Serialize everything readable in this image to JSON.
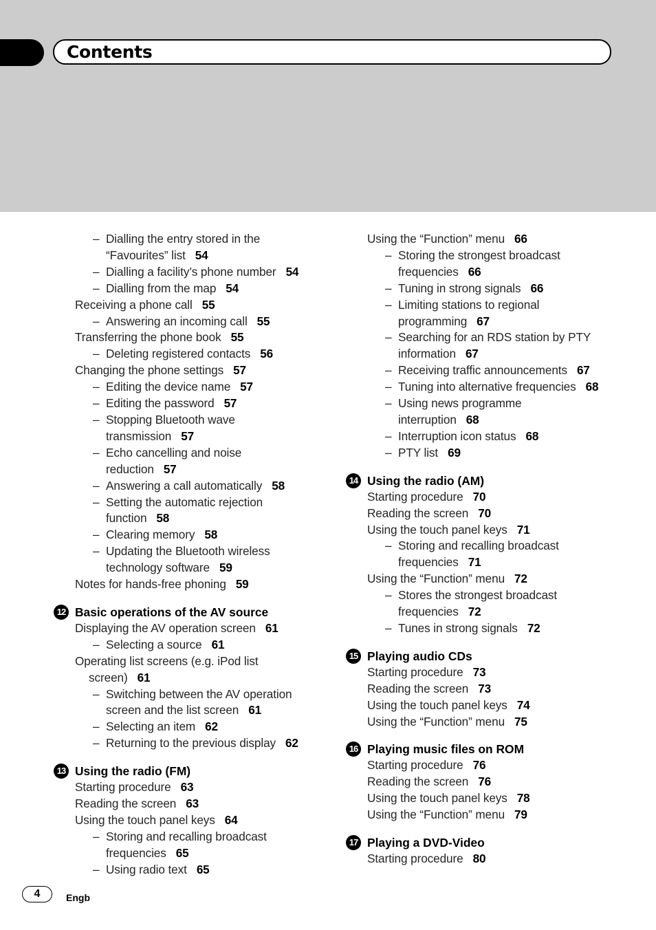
{
  "header": {
    "title": "Contents"
  },
  "left_column": {
    "intro_entries": [
      {
        "level": 2,
        "text": "Dialling the entry stored in the",
        "cont": "“Favourites” list",
        "page": "54"
      },
      {
        "level": 2,
        "text": "Dialling a facility’s phone number",
        "page": "54"
      },
      {
        "level": 2,
        "text": "Dialling from the map",
        "page": "54"
      },
      {
        "level": 1,
        "text": "Receiving a phone call",
        "page": "55"
      },
      {
        "level": 2,
        "text": "Answering an incoming call",
        "page": "55"
      },
      {
        "level": 1,
        "text": "Transferring the phone book",
        "page": "55"
      },
      {
        "level": 2,
        "text": "Deleting registered contacts",
        "page": "56"
      },
      {
        "level": 1,
        "text": "Changing the phone settings",
        "page": "57"
      },
      {
        "level": 2,
        "text": "Editing the device name",
        "page": "57"
      },
      {
        "level": 2,
        "text": "Editing the password",
        "page": "57"
      },
      {
        "level": 2,
        "text": "Stopping Bluetooth wave",
        "cont": "transmission",
        "page": "57"
      },
      {
        "level": 2,
        "text": "Echo cancelling and noise",
        "cont": "reduction",
        "page": "57"
      },
      {
        "level": 2,
        "text": "Answering a call automatically",
        "page": "58"
      },
      {
        "level": 2,
        "text": "Setting the automatic rejection",
        "cont": "function",
        "page": "58"
      },
      {
        "level": 2,
        "text": "Clearing memory",
        "page": "58"
      },
      {
        "level": 2,
        "text": "Updating the Bluetooth wireless",
        "cont": "technology software",
        "page": "59"
      },
      {
        "level": 1,
        "text": "Notes for hands-free phoning",
        "page": "59"
      }
    ],
    "sections": [
      {
        "number": "12",
        "title": "Basic operations of the AV source",
        "entries": [
          {
            "level": 1,
            "text": "Displaying the AV operation screen",
            "page": "61"
          },
          {
            "level": 2,
            "text": "Selecting a source",
            "page": "61"
          },
          {
            "level": 1,
            "text": "Operating list screens (e.g. iPod list",
            "cont": "screen)",
            "page": "61"
          },
          {
            "level": 2,
            "text": "Switching between the AV operation",
            "cont": "screen and the list screen",
            "page": "61"
          },
          {
            "level": 2,
            "text": "Selecting an item",
            "page": "62"
          },
          {
            "level": 2,
            "text": "Returning to the previous display",
            "page": "62"
          }
        ]
      },
      {
        "number": "13",
        "title": "Using the radio (FM)",
        "entries": [
          {
            "level": 1,
            "text": "Starting procedure",
            "page": "63"
          },
          {
            "level": 1,
            "text": "Reading the screen",
            "page": "63"
          },
          {
            "level": 1,
            "text": "Using the touch panel keys",
            "page": "64"
          },
          {
            "level": 2,
            "text": "Storing and recalling broadcast",
            "cont": "frequencies",
            "page": "65"
          },
          {
            "level": 2,
            "text": "Using radio text",
            "page": "65"
          }
        ]
      }
    ]
  },
  "right_column": {
    "intro_entries": [
      {
        "level": 1,
        "text": "Using the “Function” menu",
        "page": "66"
      },
      {
        "level": 2,
        "text": "Storing the strongest broadcast",
        "cont": "frequencies",
        "page": "66"
      },
      {
        "level": 2,
        "text": "Tuning in strong signals",
        "page": "66"
      },
      {
        "level": 2,
        "text": "Limiting stations to regional",
        "cont": "programming",
        "page": "67"
      },
      {
        "level": 2,
        "text": "Searching for an RDS station by PTY",
        "cont": "information",
        "page": "67"
      },
      {
        "level": 2,
        "text": "Receiving traffic announcements",
        "page": "67"
      },
      {
        "level": 2,
        "text": "Tuning into alternative frequencies",
        "page": "68"
      },
      {
        "level": 2,
        "text": "Using news programme",
        "cont": "interruption",
        "page": "68"
      },
      {
        "level": 2,
        "text": "Interruption icon status",
        "page": "68"
      },
      {
        "level": 2,
        "text": "PTY list",
        "page": "69"
      }
    ],
    "sections": [
      {
        "number": "14",
        "title": "Using the radio (AM)",
        "entries": [
          {
            "level": 1,
            "text": "Starting procedure",
            "page": "70"
          },
          {
            "level": 1,
            "text": "Reading the screen",
            "page": "70"
          },
          {
            "level": 1,
            "text": "Using the touch panel keys",
            "page": "71"
          },
          {
            "level": 2,
            "text": "Storing and recalling broadcast",
            "cont": "frequencies",
            "page": "71"
          },
          {
            "level": 1,
            "text": "Using the “Function” menu",
            "page": "72"
          },
          {
            "level": 2,
            "text": "Stores the strongest broadcast",
            "cont": "frequencies",
            "page": "72"
          },
          {
            "level": 2,
            "text": "Tunes in strong signals",
            "page": "72"
          }
        ]
      },
      {
        "number": "15",
        "title": "Playing audio CDs",
        "entries": [
          {
            "level": 1,
            "text": "Starting procedure",
            "page": "73"
          },
          {
            "level": 1,
            "text": "Reading the screen",
            "page": "73"
          },
          {
            "level": 1,
            "text": "Using the touch panel keys",
            "page": "74"
          },
          {
            "level": 1,
            "text": "Using the “Function” menu",
            "page": "75"
          }
        ]
      },
      {
        "number": "16",
        "title": "Playing music files on ROM",
        "entries": [
          {
            "level": 1,
            "text": "Starting procedure",
            "page": "76"
          },
          {
            "level": 1,
            "text": "Reading the screen",
            "page": "76"
          },
          {
            "level": 1,
            "text": "Using the touch panel keys",
            "page": "78"
          },
          {
            "level": 1,
            "text": "Using the “Function” menu",
            "page": "79"
          }
        ]
      },
      {
        "number": "17",
        "title": "Playing a DVD-Video",
        "entries": [
          {
            "level": 1,
            "text": "Starting procedure",
            "page": "80"
          }
        ]
      }
    ]
  },
  "footer": {
    "page_number": "4",
    "language": "Engb"
  },
  "colors": {
    "header_band": "#cccccc",
    "text": "#262626",
    "accent": "#000000"
  },
  "dash_glyph": "–"
}
